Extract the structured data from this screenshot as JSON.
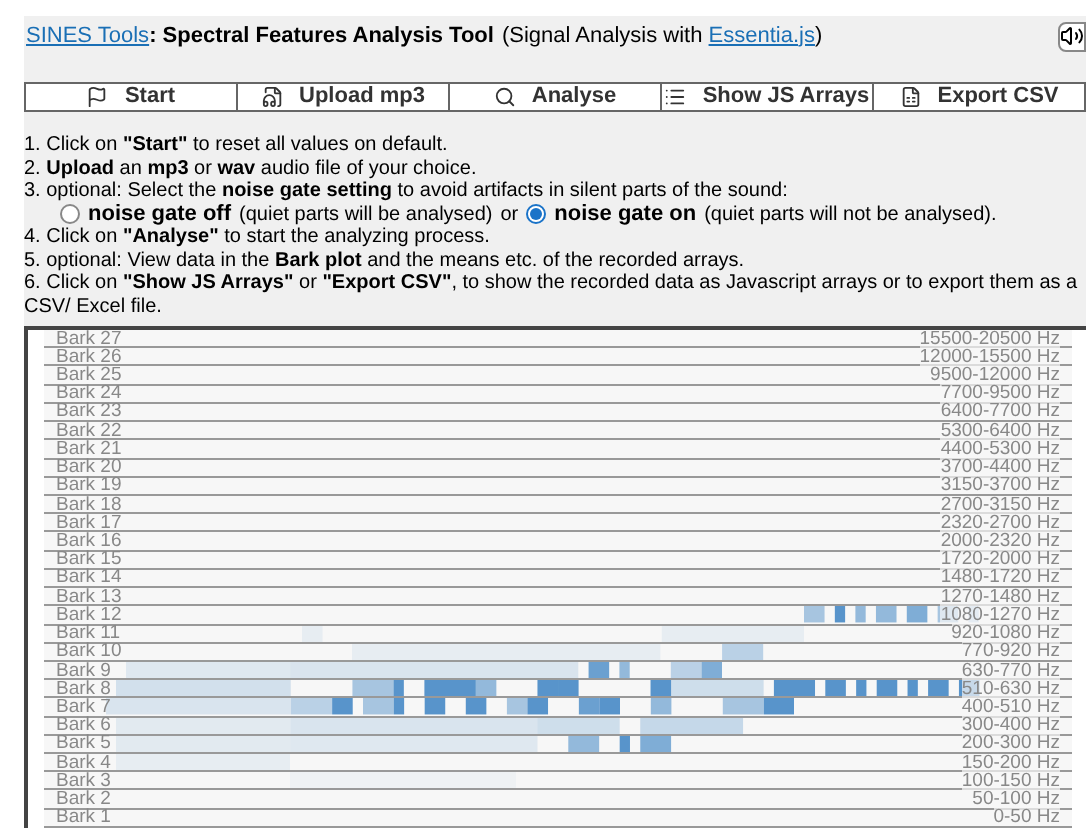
{
  "header": {
    "site_link": "SINES Tools",
    "separator": ":",
    "title": "Spectral Features Analysis Tool",
    "subtitle_open": "(Signal Analysis with ",
    "library_link": "Essentia.js",
    "subtitle_close": ")"
  },
  "toolbar": [
    {
      "label": "Start",
      "kind": "start"
    },
    {
      "label": "Upload mp3",
      "kind": "upload"
    },
    {
      "label": "Analyse",
      "kind": "analyse"
    },
    {
      "label": "Show JS Arrays",
      "kind": "arrays"
    },
    {
      "label": "Export CSV",
      "kind": "csv"
    }
  ],
  "instructions": [
    "1. Click on **\"Start\"** to reset all values on default.",
    "2. **Upload** an **mp3** or **wav** audio file of your choice.",
    "3. optional: Select the **noise gate setting** to avoid artifacts in silent parts of the sound:",
    "4. Click on **\"Analyse\"** to start the analyzing process.",
    "5. optional: View data in the **Bark plot** and the means etc. of the recorded arrays.",
    "6. Click on **\"Show JS Arrays\"** or **\"Export CSV\"**, to show the recorded data as Javascript arrays or to export them as a CSV/ Excel file."
  ],
  "noise_gate": {
    "options": [
      {
        "label": "noise gate off",
        "note": "(quiet parts will be analysed)",
        "selected": false
      },
      {
        "label": "noise gate on",
        "note": "(quiet parts will not be analysed).",
        "selected": true
      }
    ],
    "joiner": "or"
  },
  "bark_plot": [
    {
      "label": "Bark 27",
      "range": "15500-20500 Hz"
    },
    {
      "label": "Bark 26",
      "range": "12000-15500 Hz"
    },
    {
      "label": "Bark 25",
      "range": "9500-12000 Hz"
    },
    {
      "label": "Bark 24",
      "range": "7700-9500 Hz"
    },
    {
      "label": "Bark 23",
      "range": "6400-7700 Hz"
    },
    {
      "label": "Bark 22",
      "range": "5300-6400 Hz"
    },
    {
      "label": "Bark 21",
      "range": "4400-5300 Hz"
    },
    {
      "label": "Bark 20",
      "range": "3700-4400 Hz"
    },
    {
      "label": "Bark 19",
      "range": "3150-3700 Hz"
    },
    {
      "label": "Bark 18",
      "range": "2700-3150 Hz"
    },
    {
      "label": "Bark 17",
      "range": "2320-2700 Hz"
    },
    {
      "label": "Bark 16",
      "range": "2000-2320 Hz"
    },
    {
      "label": "Bark 15",
      "range": "1720-2000 Hz"
    },
    {
      "label": "Bark 14",
      "range": "1480-1720 Hz"
    },
    {
      "label": "Bark 13",
      "range": "1270-1480 Hz"
    },
    {
      "label": "Bark 12",
      "range": "1080-1270 Hz"
    },
    {
      "label": "Bark 11",
      "range": "920-1080 Hz"
    },
    {
      "label": "Bark 10",
      "range": "770-920 Hz"
    },
    {
      "label": "Bark 9",
      "range": "630-770 Hz"
    },
    {
      "label": "Bark 8",
      "range": "510-630 Hz"
    },
    {
      "label": "Bark 7",
      "range": "400-510 Hz"
    },
    {
      "label": "Bark 6",
      "range": "300-400 Hz"
    },
    {
      "label": "Bark 5",
      "range": "200-300 Hz"
    },
    {
      "label": "Bark 4",
      "range": "150-200 Hz"
    },
    {
      "label": "Bark 3",
      "range": "100-150 Hz"
    },
    {
      "label": "Bark 2",
      "range": "50-100 Hz"
    },
    {
      "label": "Bark 1",
      "range": "0-50 Hz"
    }
  ]
}
